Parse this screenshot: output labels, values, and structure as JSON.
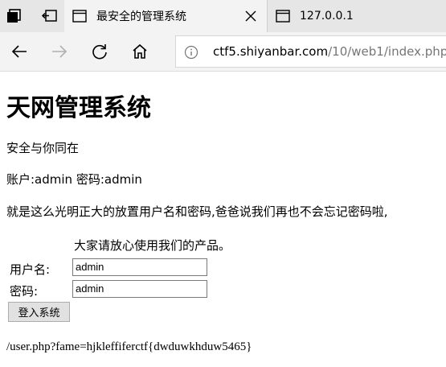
{
  "browser": {
    "tabs": [
      {
        "title": "最安全的管理系统",
        "active": true
      },
      {
        "title": "127.0.0.1",
        "active": false
      }
    ],
    "address": {
      "host": "ctf5.shiyanbar.com",
      "path": "/10/web1/index.php"
    }
  },
  "page": {
    "heading": "天网管理系统",
    "tagline": "安全与你同在",
    "credentials": "账户:admin  密码:admin",
    "notice": "就是这么光明正大的放置用户名和密码,爸爸说我们再也不会忘记密码啦,",
    "form": {
      "promo": "大家请放心使用我们的产品。",
      "username_label": "用户名:",
      "username_value": "admin",
      "password_label": "密码:",
      "password_value": "admin",
      "submit_label": "登入系统"
    },
    "hint": "/user.php?fame=hjkleffiferctf{dwduwkhduw5465}"
  }
}
